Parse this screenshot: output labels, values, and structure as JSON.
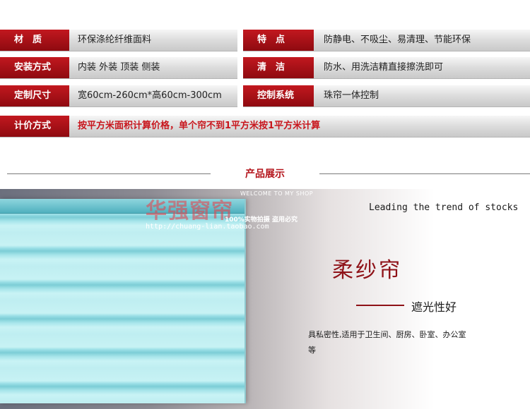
{
  "specs": [
    [
      {
        "label": "材　质",
        "value": "环保涤纶纤维面料"
      },
      {
        "label": "特　点",
        "value": "防静电、不吸尘、易清理、节能环保"
      }
    ],
    [
      {
        "label": "安装方式",
        "value": "内装 外装 顶装 侧装"
      },
      {
        "label": "清　洁",
        "value": "防水、用洗洁精直接擦洗即可"
      }
    ],
    [
      {
        "label": "定制尺寸",
        "value": "宽60cm-260cm*高60cm-300cm"
      },
      {
        "label": "控制系统",
        "value": "珠帘一体控制"
      }
    ]
  ],
  "pricing": {
    "label": "计价方式",
    "value": "按平方米面积计算价格，单个帘不到1平方米按1平方米计算"
  },
  "section_title": "产品展示",
  "banner": {
    "shop_name": "华强窗帘",
    "welcome": "WELCOME TO MY SHOP",
    "watermark": "100%实物拍摄  盗用必究",
    "shop_url": "http://chuang-lian.taobao.com",
    "tagline": "Leading the trend of stocks",
    "product_name": "柔纱帘",
    "feature": "遮光性好",
    "description": "具私密性,适用于卫生间、厨房、卧室、办公室等"
  },
  "colors": {
    "accent": "#b4141b",
    "label_bg": "#a51118"
  }
}
